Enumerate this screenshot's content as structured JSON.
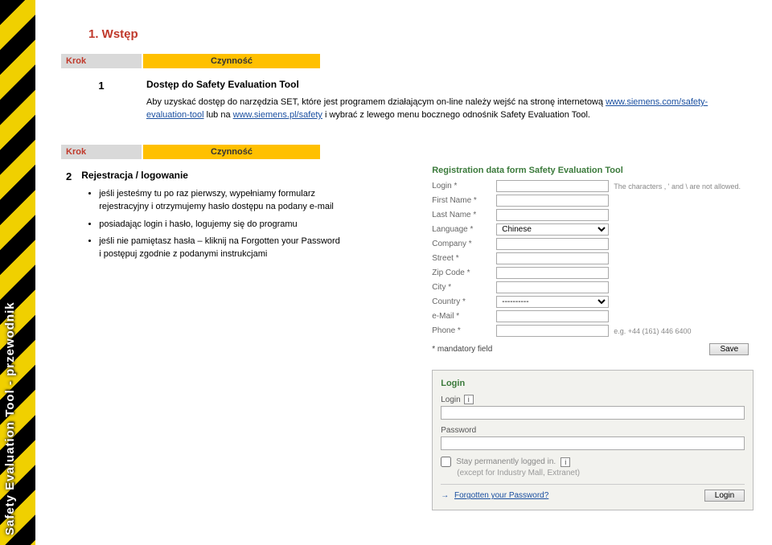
{
  "sidebar_label": "Safety Evaluation Tool - przewodnik",
  "title": "1. Wstęp",
  "headers": {
    "krok": "Krok",
    "czynnosc": "Czynność"
  },
  "step1": {
    "num": "1",
    "title": "Dostęp do Safety Evaluation Tool",
    "text_a": "Aby uzyskać dostęp do narzędzia SET, które jest programem działającym on-line należy wejść na stronę internetową ",
    "link1": "www.siemens.com/safety-evaluation-tool",
    "text_b": " lub na ",
    "link2": "www.siemens.pl/safety",
    "text_c": " i wybrać z lewego menu bocznego odnośnik Safety Evaluation Tool."
  },
  "step2": {
    "num": "2",
    "title": "Rejestracja / logowanie",
    "bullets": [
      "jeśli jesteśmy tu po raz pierwszy, wypełniamy formularz rejestracyjny i otrzymujemy hasło dostępu na podany e-mail",
      "posiadając login i hasło, logujemy się do programu",
      "jeśli nie pamiętasz hasła – kliknij na Forgotten your Password i postępuj zgodnie z podanymi instrukcjami"
    ]
  },
  "reg": {
    "heading": "Registration data form Safety Evaluation Tool",
    "note_chars": "The characters , ' and \\ are not allowed.",
    "fields": {
      "login": "Login *",
      "first_name": "First Name *",
      "last_name": "Last Name *",
      "language": "Language *",
      "language_value": "Chinese",
      "company": "Company *",
      "street": "Street *",
      "zip": "Zip Code *",
      "city": "City *",
      "country": "Country *",
      "country_value": "----------",
      "email": "e-Mail *",
      "phone": "Phone *",
      "phone_hint": "e.g. +44 (161) 446 6400"
    },
    "mandatory": "* mandatory field",
    "save": "Save"
  },
  "login": {
    "heading": "Login",
    "login_label": "Login",
    "password_label": "Password",
    "stay": "Stay permanently logged in.",
    "except": "(except for Industry Mall, Extranet)",
    "forgot": "Forgotten your Password?",
    "button": "Login"
  }
}
